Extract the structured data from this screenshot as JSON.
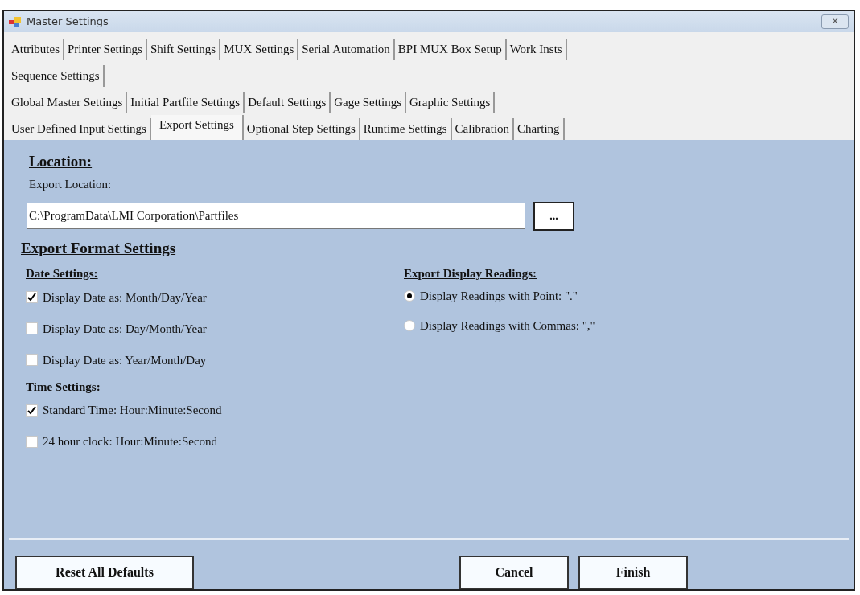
{
  "window": {
    "title": "Master Settings",
    "close": "✕"
  },
  "tab_rows": [
    [
      {
        "label": "Attributes",
        "selected": false
      },
      {
        "label": "Printer Settings",
        "selected": false
      },
      {
        "label": "Shift Settings",
        "selected": false
      },
      {
        "label": "MUX Settings",
        "selected": false
      },
      {
        "label": "Serial Automation",
        "selected": false
      },
      {
        "label": "BPI MUX Box Setup",
        "selected": false
      },
      {
        "label": "Work Insts",
        "selected": false
      }
    ],
    [
      {
        "label": "Sequence Settings",
        "selected": false
      }
    ],
    [
      {
        "label": "Global Master Settings",
        "selected": false
      },
      {
        "label": "Initial Partfile Settings",
        "selected": false
      },
      {
        "label": "Default Settings",
        "selected": false
      },
      {
        "label": "Gage Settings",
        "selected": false
      },
      {
        "label": "Graphic Settings",
        "selected": false
      }
    ],
    [
      {
        "label": "User Defined Input Settings",
        "selected": false
      },
      {
        "label": "Export Settings",
        "selected": true
      },
      {
        "label": "Optional Step Settings",
        "selected": false
      },
      {
        "label": "Runtime Settings",
        "selected": false
      },
      {
        "label": "Calibration",
        "selected": false
      },
      {
        "label": "Charting",
        "selected": false
      }
    ]
  ],
  "location": {
    "heading": "Location:",
    "label": "Export Location:",
    "value": "C:\\ProgramData\\LMI Corporation\\Partfiles",
    "browse": "..."
  },
  "format": {
    "heading": "Export Format Settings",
    "date_settings": {
      "heading": "Date Settings:",
      "options": [
        {
          "label": "Display Date as: Month/Day/Year",
          "checked": true
        },
        {
          "label": "Display Date as: Day/Month/Year",
          "checked": false
        },
        {
          "label": "Display Date as: Year/Month/Day",
          "checked": false
        }
      ]
    },
    "time_settings": {
      "heading": "Time Settings:",
      "options": [
        {
          "label": "Standard Time: Hour:Minute:Second",
          "checked": true
        },
        {
          "label": "24 hour clock: Hour:Minute:Second",
          "checked": false
        }
      ]
    },
    "readings": {
      "heading": "Export Display Readings:",
      "options": [
        {
          "label": "Display Readings with Point: \".\"",
          "selected": true
        },
        {
          "label": "Display Readings with Commas: \",\"",
          "selected": false
        }
      ]
    }
  },
  "buttons": {
    "reset": "Reset All Defaults",
    "cancel": "Cancel",
    "finish": "Finish"
  }
}
